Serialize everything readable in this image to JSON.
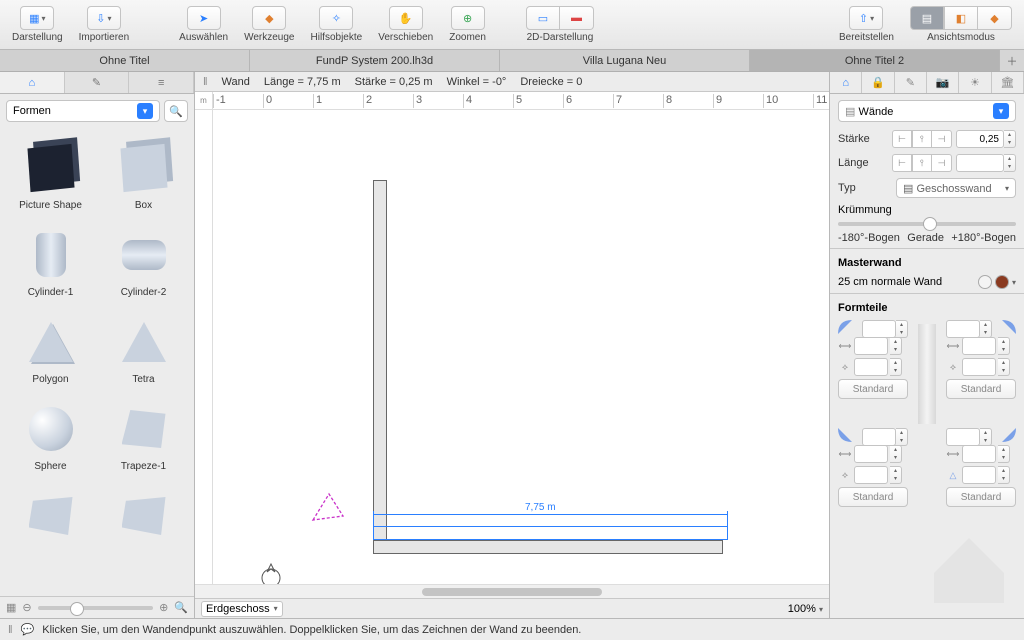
{
  "toolbar": {
    "groups": [
      {
        "label": "Darstellung",
        "icon": "layout-icon",
        "dropdown": true
      },
      {
        "label": "Importieren",
        "icon": "import-icon",
        "dropdown": true
      },
      {
        "label": "Auswählen",
        "icon": "pointer-icon"
      },
      {
        "label": "Werkzeuge",
        "icon": "tools-icon"
      },
      {
        "label": "Hilfsobjekte",
        "icon": "guides-icon"
      },
      {
        "label": "Verschieben",
        "icon": "hand-icon"
      },
      {
        "label": "Zoomen",
        "icon": "zoom-icon"
      },
      {
        "label": "2D-Darstellung",
        "icon": "view2d-icon",
        "segmented": true
      },
      {
        "label": "Bereitstellen",
        "icon": "share-icon",
        "dropdown": true
      },
      {
        "label": "Ansichtsmodus",
        "icon": "viewmode-icon",
        "segmented3": true
      }
    ]
  },
  "tabs": [
    "Ohne Titel",
    "FundP System 200.lh3d",
    "Villa Lugana Neu",
    "Ohne Titel 2"
  ],
  "active_tab": 3,
  "left": {
    "combo": "Formen",
    "shapes": [
      {
        "name": "Picture Shape",
        "cls": "sp-cube"
      },
      {
        "name": "Box",
        "cls": "sp-box"
      },
      {
        "name": "Cylinder-1",
        "cls": "sp-cyl1"
      },
      {
        "name": "Cylinder-2",
        "cls": "sp-cyl2"
      },
      {
        "name": "Polygon",
        "cls": "sp-poly"
      },
      {
        "name": "Tetra",
        "cls": "sp-tetra"
      },
      {
        "name": "Sphere",
        "cls": "sp-sphere"
      },
      {
        "name": "Trapeze-1",
        "cls": "sp-trap"
      },
      {
        "name": "",
        "cls": "sp-generic"
      },
      {
        "name": "",
        "cls": "sp-generic"
      }
    ]
  },
  "infobar": {
    "object": "Wand",
    "length_label": "Länge = 7,75 m",
    "thickness_label": "Stärke = 0,25 m",
    "angle_label": "Winkel = -0°",
    "triangles_label": "Dreiecke = 0"
  },
  "ruler_h": [
    "-1",
    "0",
    "1",
    "2",
    "3",
    "4",
    "5",
    "6",
    "7",
    "8",
    "9",
    "10",
    "11"
  ],
  "canvas": {
    "dimension_label": "7,75 m",
    "floor": "Erdgeschoss",
    "zoom": "100%"
  },
  "inspector": {
    "category": "Wände",
    "thickness_label": "Stärke",
    "thickness_value": "0,25",
    "length_label": "Länge",
    "type_label": "Typ",
    "type_value": "Geschosswand",
    "curvature_label": "Krümmung",
    "curve_min": "-180°-Bogen",
    "curve_mid": "Gerade",
    "curve_max": "+180°-Bogen",
    "master_title": "Masterwand",
    "master_value": "25 cm normale Wand",
    "formteile_title": "Formteile",
    "standard_label": "Standard"
  },
  "status": {
    "hint": "Klicken Sie, um den Wandendpunkt auszuwählen. Doppelklicken Sie, um das Zeichnen der Wand zu beenden."
  }
}
